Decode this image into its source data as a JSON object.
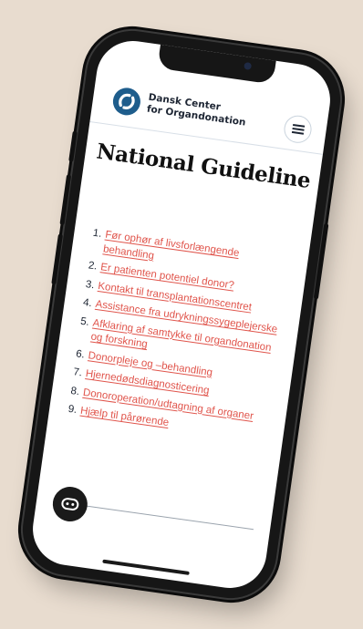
{
  "header": {
    "brand_line1": "Dansk Center",
    "brand_line2": "for Organdonation",
    "menu_icon": "hamburger-icon"
  },
  "page": {
    "title": "National Guideline"
  },
  "toc": [
    {
      "num": "1.",
      "label": "Før ophør af livsforlængende behandling"
    },
    {
      "num": "2.",
      "label": "Er patienten potentiel donor?"
    },
    {
      "num": "3.",
      "label": "Kontakt til transplantationscentret"
    },
    {
      "num": "4.",
      "label": "Assistance fra udrykningssygeplejerske"
    },
    {
      "num": "5.",
      "label": "Afklaring af samtykke til organdonation og forskning"
    },
    {
      "num": "6.",
      "label": "Donorpleje og –behandling"
    },
    {
      "num": "7.",
      "label": "Hjernedødsdiagnosticering"
    },
    {
      "num": "8.",
      "label": "Donoroperation/udtagning af organer"
    },
    {
      "num": "9.",
      "label": "Hjælp til pårørende"
    }
  ],
  "chat_fab": {
    "icon": "chat-icon"
  },
  "colors": {
    "background": "#e8dccf",
    "brand_blue": "#1e5d8c",
    "link_red": "#e0544b",
    "text_dark": "#1d2533"
  }
}
